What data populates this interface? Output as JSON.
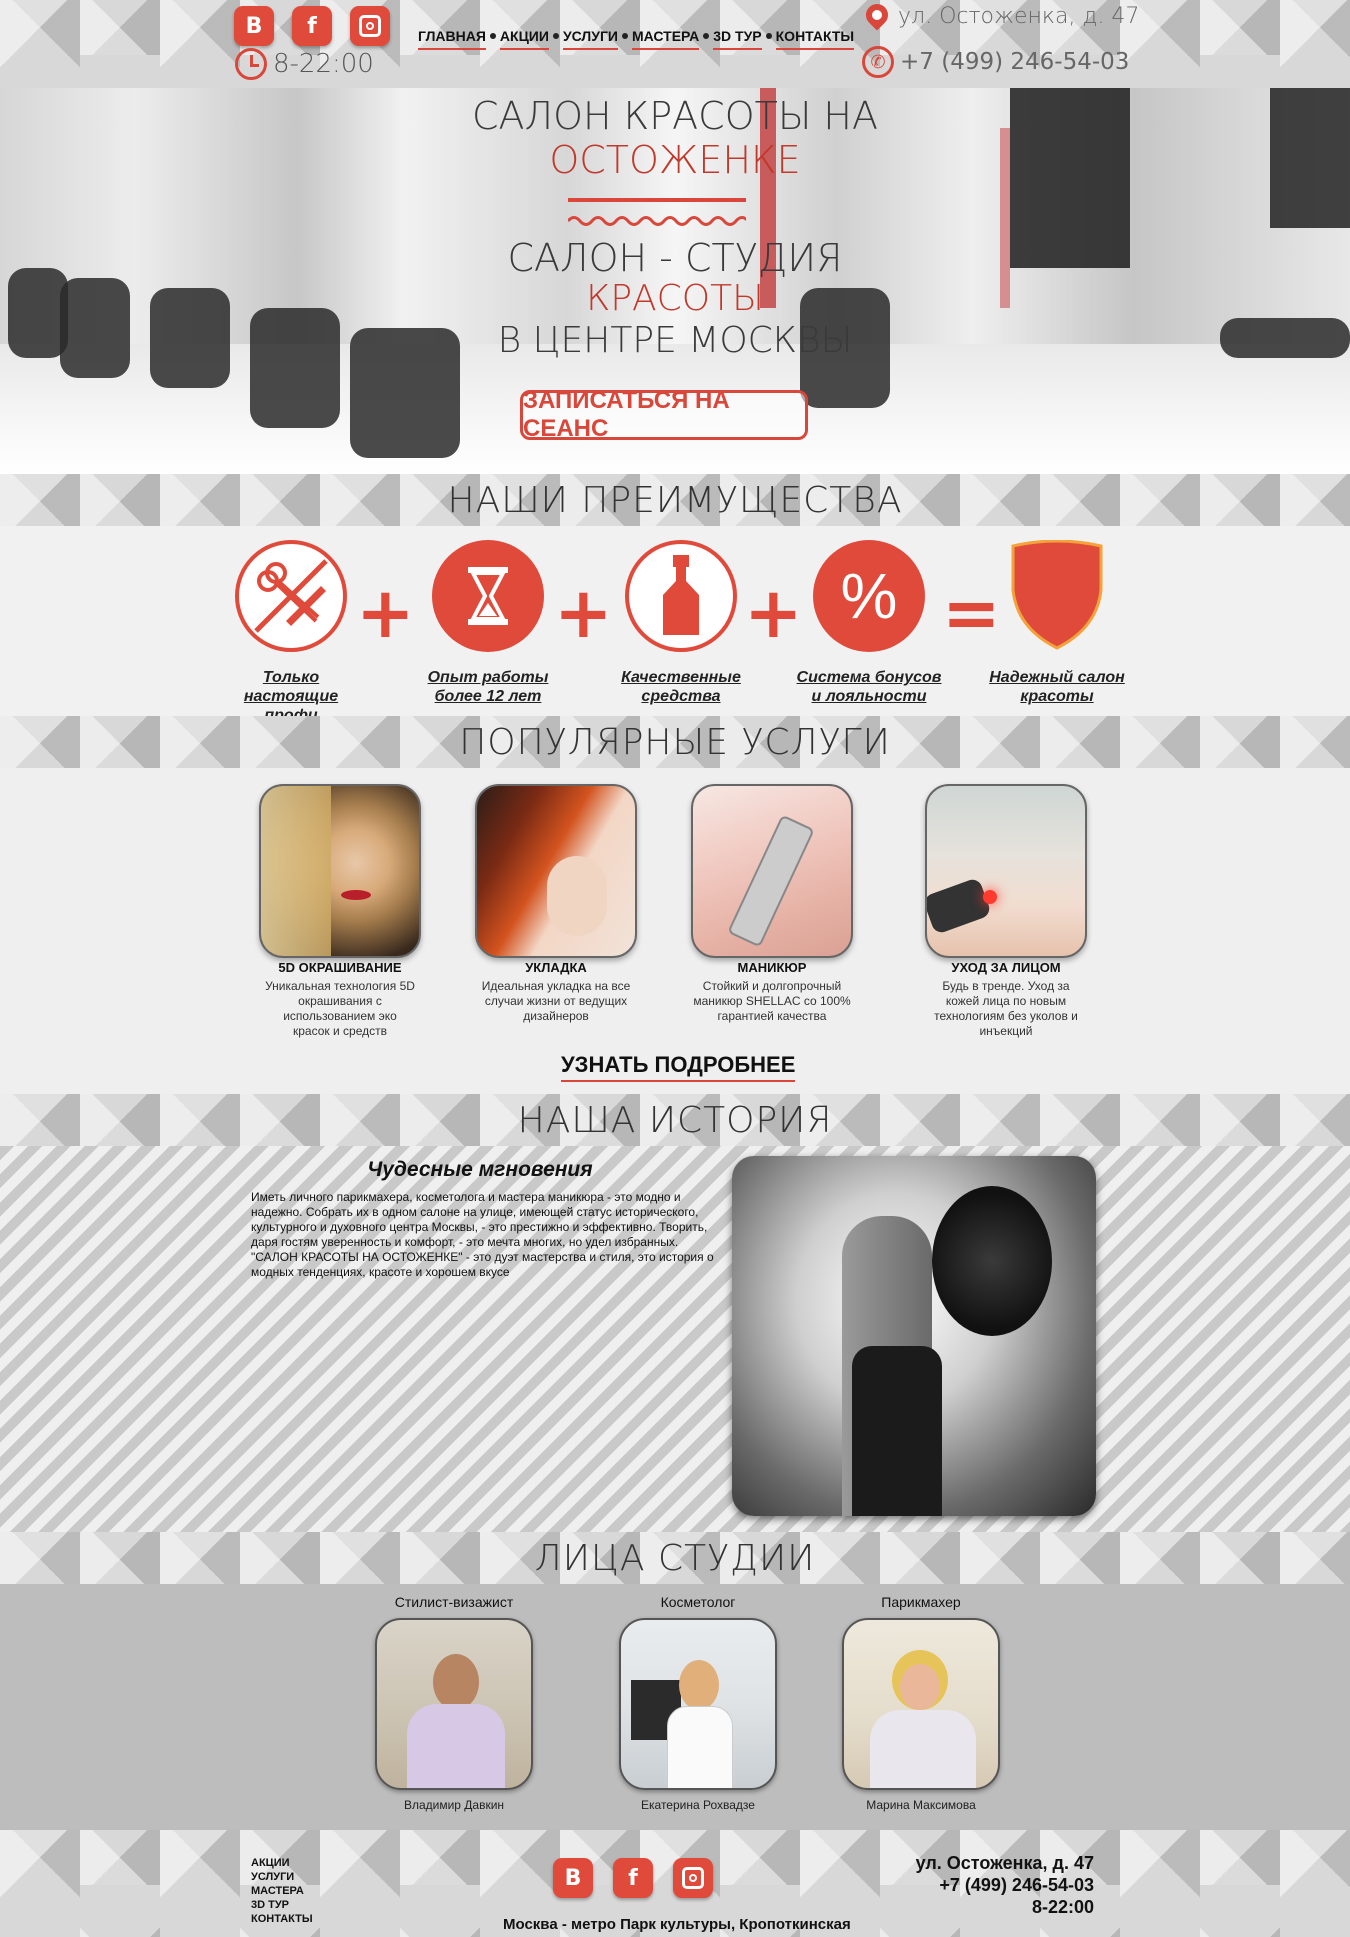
{
  "header": {
    "social": [
      "В",
      "f",
      "◘"
    ],
    "hours": "8-22:00",
    "nav": [
      "ГЛАВНАЯ",
      "АКЦИИ",
      "УСЛУГИ",
      "МАСТЕРА",
      "3D ТУР",
      "КОНТАКТЫ"
    ],
    "address": "ул. Остоженка, д. 47",
    "phone": "+7 (499) 246-54-03"
  },
  "hero": {
    "line1": "САЛОН КРАСОТЫ НА",
    "line2": "ОСТОЖЕНКЕ",
    "line3": "САЛОН - СТУДИЯ",
    "line4": "КРАСОТЫ",
    "line5": "В ЦЕНТРЕ МОСКВЫ",
    "cta": "ЗАПИСАТЬСЯ НА СЕАНС"
  },
  "advantages": {
    "title": "НАШИ ПРЕИМУЩЕСТВА",
    "items": [
      {
        "label1": "Только настоящие",
        "label2": "профи",
        "icon": "scissors-comb-icon"
      },
      {
        "label1": "Опыт работы",
        "label2": "более 12 лет",
        "icon": "hourglass-icon"
      },
      {
        "label1": "Качественные",
        "label2": "средства",
        "icon": "bottle-icon"
      },
      {
        "label1": "Система бонусов",
        "label2": "и лояльности",
        "icon": "percent-icon"
      },
      {
        "label1": "Надежный салон",
        "label2": "красоты",
        "icon": "shield-icon"
      }
    ],
    "operators": [
      "+",
      "+",
      "+",
      "="
    ],
    "accent": "#e04a3b"
  },
  "services": {
    "title": "ПОПУЛЯРНЫЕ УСЛУГИ",
    "items": [
      {
        "title": "5D ОКРАШИВАНИЕ",
        "desc": "Уникальная технология 5D окрашивания с использованием эко красок и средств"
      },
      {
        "title": "УКЛАДКА",
        "desc": "Идеальная укладка на все случаи жизни от ведущих дизайнеров"
      },
      {
        "title": "МАНИКЮР",
        "desc": "Стойкий и долгопрочный маникюр SHELLAC со 100% гарантией качества"
      },
      {
        "title": "УХОД ЗА ЛИЦОМ",
        "desc": "Будь в тренде. Уход за кожей лица по новым технологиям без уколов и инъекций"
      }
    ],
    "more": "УЗНАТЬ ПОДРОБНЕЕ"
  },
  "history": {
    "title": "НАША ИСТОРИЯ",
    "subtitle": "Чудесные мгновения",
    "text": "Иметь личного парикмахера, косметолога и мастера маникюра - это модно и надежно. Собрать их в одном салоне на улице, имеющей статус исторического, культурного и духовного центра Москвы, - это престижно и эффективно. Творить, даря гостям уверенность и комфорт, - это мечта многих, но удел избранных.\n\"САЛОН КРАСОТЫ НА ОСТОЖЕНКЕ\" - это дуэт мастерства и стиля, это история о модных тенденциях, красоте и хорошем вкусе"
  },
  "faces": {
    "title": "ЛИЦА СТУДИИ",
    "people": [
      {
        "role": "Стилист-визажист",
        "name": "Владимир Давкин"
      },
      {
        "role": "Косметолог",
        "name": "Екатерина Рохвадзе"
      },
      {
        "role": "Парикмахер",
        "name": "Марина Максимова"
      }
    ]
  },
  "footer": {
    "nav": [
      "АКЦИИ",
      "УСЛУГИ",
      "МАСТЕРА",
      "3D ТУР",
      "КОНТАКТЫ"
    ],
    "metro": "Москва - метро Парк культуры, Кропоткинская",
    "address": "ул. Остоженка, д. 47",
    "phone": "+7 (499) 246-54-03",
    "hours": "8-22:00"
  }
}
